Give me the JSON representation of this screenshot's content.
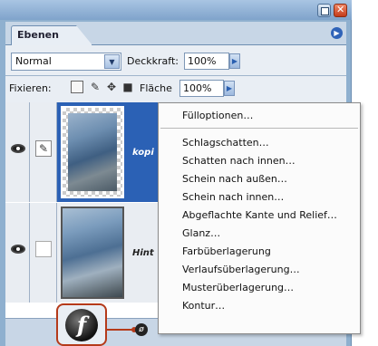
{
  "panel": {
    "tab_label": "Ebenen"
  },
  "blend": {
    "mode_value": "Normal",
    "opacity_label": "Deckkraft:",
    "opacity_value": "100%"
  },
  "lock": {
    "label": "Fixieren:",
    "fill_label": "Fläche",
    "fill_value": "100%"
  },
  "layers": [
    {
      "name": "kopi",
      "selected": true
    },
    {
      "name": "Hint",
      "selected": false
    }
  ],
  "context_menu": {
    "items": [
      "Fülloptionen…",
      "Schlagschatten…",
      "Schatten nach innen…",
      "Schein nach außen…",
      "Schein nach innen…",
      "Abgeflachte Kante und Relief…",
      "Glanz…",
      "Farbüberlagerung",
      "Verlaufsüberlagerung…",
      "Musterüberlagerung…",
      "Kontur…"
    ]
  },
  "icons": {
    "fx": "f",
    "small_fx": "ø"
  },
  "colors": {
    "selected_layer": "#2b61b5",
    "highlight": "#b53a1a"
  }
}
